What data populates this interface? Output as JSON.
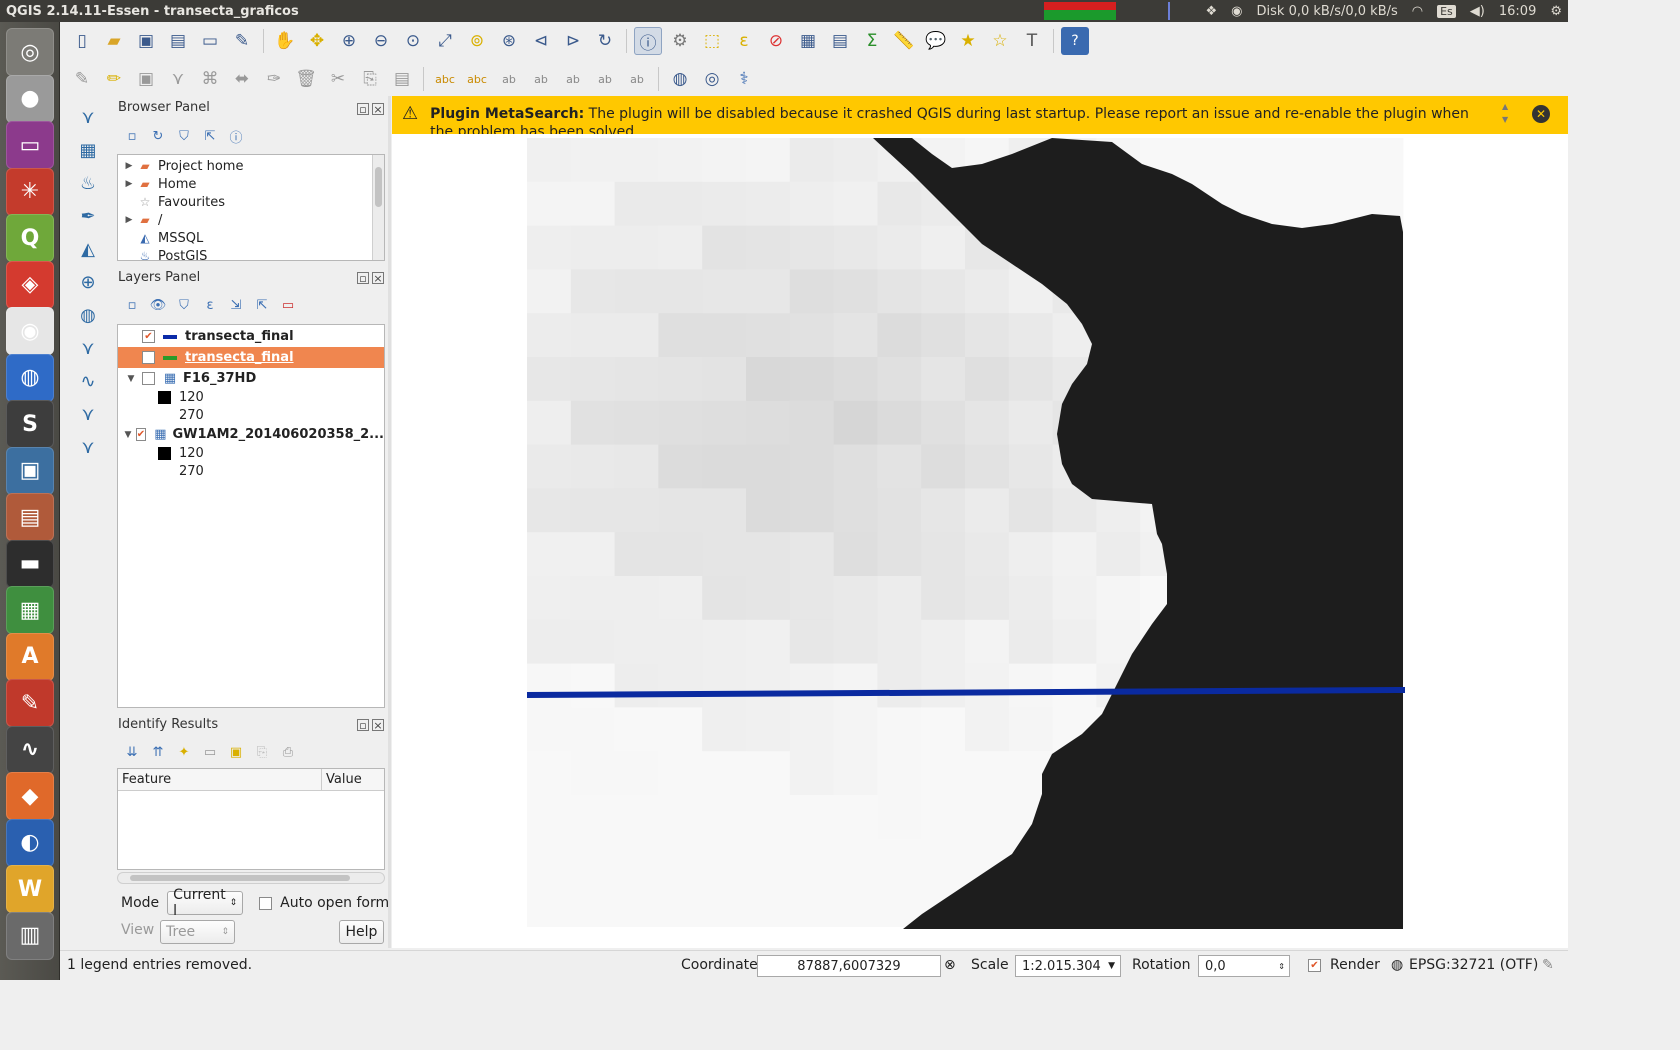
{
  "window_title": "QGIS 2.14.11-Essen - transecta_graficos",
  "system": {
    "disk": "Disk 0,0 kB/s/0,0 kB/s",
    "keyboard": "Es",
    "time": "16:09"
  },
  "launcher_items": [
    {
      "icon": "ubuntu-dash-icon",
      "color": "#7c7b76",
      "glyph": "◎"
    },
    {
      "icon": "disk-utility-icon",
      "color": "#9a9a9a",
      "glyph": "●"
    },
    {
      "icon": "presentation-icon",
      "color": "#8c3a8c",
      "glyph": "▭"
    },
    {
      "icon": "network-icon",
      "color": "#c43b2c",
      "glyph": "✳"
    },
    {
      "icon": "qgis-icon",
      "color": "#6fa83a",
      "glyph": "Q"
    },
    {
      "icon": "app-red-icon",
      "color": "#d43a2f",
      "glyph": "◈"
    },
    {
      "icon": "chrome-icon",
      "color": "#e6e6e6",
      "glyph": "◉"
    },
    {
      "icon": "google-earth-icon",
      "color": "#2f6bc7",
      "glyph": "◍"
    },
    {
      "icon": "sublime-text-icon",
      "color": "#3d3d3d",
      "glyph": "S"
    },
    {
      "icon": "image-viewer-icon",
      "color": "#3c6fa0",
      "glyph": "▣"
    },
    {
      "icon": "files-icon",
      "color": "#b05a3a",
      "glyph": "▤"
    },
    {
      "icon": "terminal-icon",
      "color": "#2d2d2d",
      "glyph": "▬"
    },
    {
      "icon": "spreadsheet-icon",
      "color": "#3f8f3f",
      "glyph": "▦"
    },
    {
      "icon": "software-center-icon",
      "color": "#e07a2a",
      "glyph": "A"
    },
    {
      "icon": "text-editor-icon",
      "color": "#c0392b",
      "glyph": "✎"
    },
    {
      "icon": "system-monitor-icon",
      "color": "#444",
      "glyph": "∿"
    },
    {
      "icon": "app-orange-icon",
      "color": "#e0692a",
      "glyph": "◆"
    },
    {
      "icon": "app-blue-icon",
      "color": "#2a60b0",
      "glyph": "◐"
    },
    {
      "icon": "app-yellow-icon",
      "color": "#e0a52a",
      "glyph": "W"
    },
    {
      "icon": "trash-icon",
      "color": "#6a6a6a",
      "glyph": "▥"
    }
  ],
  "browser_panel": {
    "title": "Browser Panel",
    "items": [
      {
        "label": "Project home",
        "icon": "folder-icon",
        "expandable": true
      },
      {
        "label": "Home",
        "icon": "folder-icon",
        "expandable": true
      },
      {
        "label": "Favourites",
        "icon": "star-icon",
        "expandable": false
      },
      {
        "label": "/",
        "icon": "folder-icon",
        "expandable": true
      },
      {
        "label": "MSSQL",
        "icon": "database-icon",
        "expandable": false
      },
      {
        "label": "PostGIS",
        "icon": "elephant-icon",
        "expandable": false
      }
    ]
  },
  "layers_panel": {
    "title": "Layers Panel",
    "layers": [
      {
        "name": "transecta_final",
        "checked": true,
        "selected": false,
        "swatch": "#0b2aa8"
      },
      {
        "name": "transecta_final",
        "checked": false,
        "selected": true,
        "swatch": "#2a9a2a"
      },
      {
        "name": "F16_37HD",
        "checked": false,
        "selected": false,
        "legend": [
          "120",
          "270"
        ]
      },
      {
        "name": "GW1AM2_201406020358_2...",
        "checked": true,
        "selected": false,
        "legend": [
          "120",
          "270"
        ]
      }
    ]
  },
  "identify_panel": {
    "title": "Identify Results",
    "columns": [
      "Feature",
      "Value"
    ],
    "mode_label": "Mode",
    "mode_value": "Current l",
    "auto_open_label": "Auto open form",
    "view_label": "View",
    "view_value": "Tree",
    "help_label": "Help"
  },
  "message_bar": {
    "bold": "Plugin MetaSearch:",
    "text": " The plugin will be disabled because it crashed QGIS during last startup. Please report an issue and re-enable the plugin when the problem has been solved."
  },
  "status_bar": {
    "message": "1 legend entries removed.",
    "coordinate_label": "Coordinate",
    "coordinate": "87887,6007329",
    "scale_label": "Scale",
    "scale": "1:2.015.304",
    "rotation_label": "Rotation",
    "rotation": "0,0",
    "render_label": "Render",
    "crs": "EPSG:32721 (OTF)"
  },
  "map": {
    "transect_color": "#0a2aa0"
  }
}
